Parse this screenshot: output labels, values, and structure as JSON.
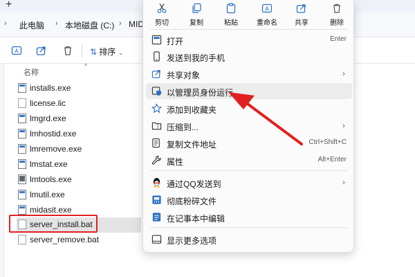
{
  "address": {
    "segments": [
      "此电脑",
      "本地磁盘 (C:)",
      "MID"
    ]
  },
  "toolbar": {
    "sort_label": "排序"
  },
  "file_list": {
    "column_name": "名称",
    "files": [
      {
        "name": "installs.exe",
        "icon": "exe-file-icon"
      },
      {
        "name": "license.lic",
        "icon": "document-file-icon"
      },
      {
        "name": "lmgrd.exe",
        "icon": "exe-file-icon"
      },
      {
        "name": "lmhostid.exe",
        "icon": "exe-file-icon"
      },
      {
        "name": "lmremove.exe",
        "icon": "exe-file-icon"
      },
      {
        "name": "lmstat.exe",
        "icon": "exe-file-icon"
      },
      {
        "name": "lmtools.exe",
        "icon": "tool-exe-icon"
      },
      {
        "name": "lmutil.exe",
        "icon": "exe-file-icon"
      },
      {
        "name": "midasit.exe",
        "icon": "exe-file-icon"
      },
      {
        "name": "server_install.bat",
        "icon": "batch-file-icon",
        "selected": true
      },
      {
        "name": "server_remove.bat",
        "icon": "batch-file-icon"
      }
    ]
  },
  "context_menu": {
    "quick_actions": [
      {
        "label": "剪切",
        "icon": "scissors-icon"
      },
      {
        "label": "复制",
        "icon": "copy-icon"
      },
      {
        "label": "粘贴",
        "icon": "paste-icon"
      },
      {
        "label": "重命名",
        "icon": "rename-icon"
      },
      {
        "label": "共享",
        "icon": "share-icon"
      },
      {
        "label": "删除",
        "icon": "trash-icon"
      }
    ],
    "items": [
      {
        "label": "打开",
        "shortcut": "Enter",
        "icon": "open-icon"
      },
      {
        "label": "发送到我的手机",
        "shortcut": "",
        "icon": "phone-icon"
      },
      {
        "label": "共享对象",
        "shortcut": "",
        "icon": "share-icon",
        "submenu": true
      },
      {
        "label": "以管理员身份运行",
        "shortcut": "",
        "icon": "admin-shield-icon",
        "hover": true
      },
      {
        "label": "添加到收藏夹",
        "shortcut": "",
        "icon": "star-icon"
      },
      {
        "label": "压缩到...",
        "shortcut": "",
        "icon": "zip-folder-icon",
        "submenu": true
      },
      {
        "label": "复制文件地址",
        "shortcut": "Ctrl+Shift+C",
        "icon": "copy-path-icon"
      },
      {
        "label": "属性",
        "shortcut": "Alt+Enter",
        "icon": "wrench-icon"
      },
      {
        "label": "通过QQ发送到",
        "shortcut": "",
        "icon": "qq-penguin-icon",
        "submenu": true
      },
      {
        "label": "彻底粉碎文件",
        "shortcut": "",
        "icon": "shredder-icon"
      },
      {
        "label": "在记事本中编辑",
        "shortcut": "",
        "icon": "notepad-icon"
      },
      {
        "label": "显示更多选项",
        "shortcut": "",
        "icon": "more-options-icon"
      }
    ]
  },
  "colors": {
    "annotation_red": "#e02020",
    "accent_blue": "#3a78c6"
  }
}
